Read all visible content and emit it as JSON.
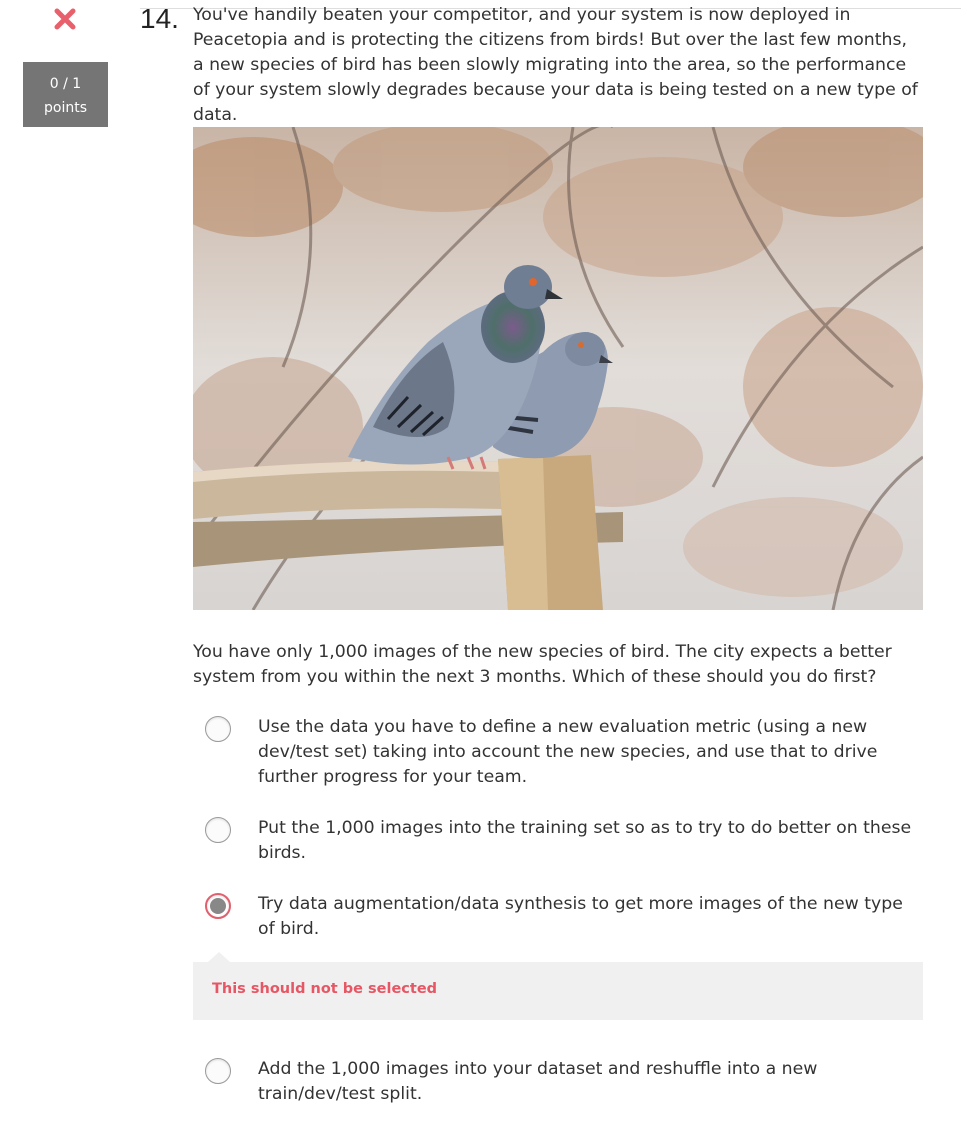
{
  "status": {
    "icon": "close-icon",
    "icon_color": "#e8606c",
    "score": "0 / 1",
    "score_unit": "points"
  },
  "question": {
    "number": "14.",
    "text": "You've handily beaten your competitor, and your system is now deployed in Peacetopia and is protecting the citizens from birds! But over the last few months, a new species of bird has been slowly migrating into the area, so the performance of your system slowly degrades because your data is being tested on a new type of data.",
    "image": "photo of two pigeons perched on a wooden post",
    "prompt": "You have only 1,000 images of the new species of bird. The city expects a better system from you within the next 3 months. Which of these should you do first?"
  },
  "options": [
    {
      "label": "Use the data you have to define a new evaluation metric (using a new dev/test set) taking into account the new species, and use that to drive further progress for your team.",
      "selected": false
    },
    {
      "label": "Put the 1,000 images into the training set so as to try to do better on these birds.",
      "selected": false
    },
    {
      "label": "Try data augmentation/data synthesis to get more images of the new type of bird.",
      "selected": true
    },
    {
      "label": "Add the 1,000 images into your dataset and reshuffle into a new train/dev/test split.",
      "selected": false
    }
  ],
  "feedback": {
    "text": "This should not be selected",
    "color": "#e65765"
  }
}
